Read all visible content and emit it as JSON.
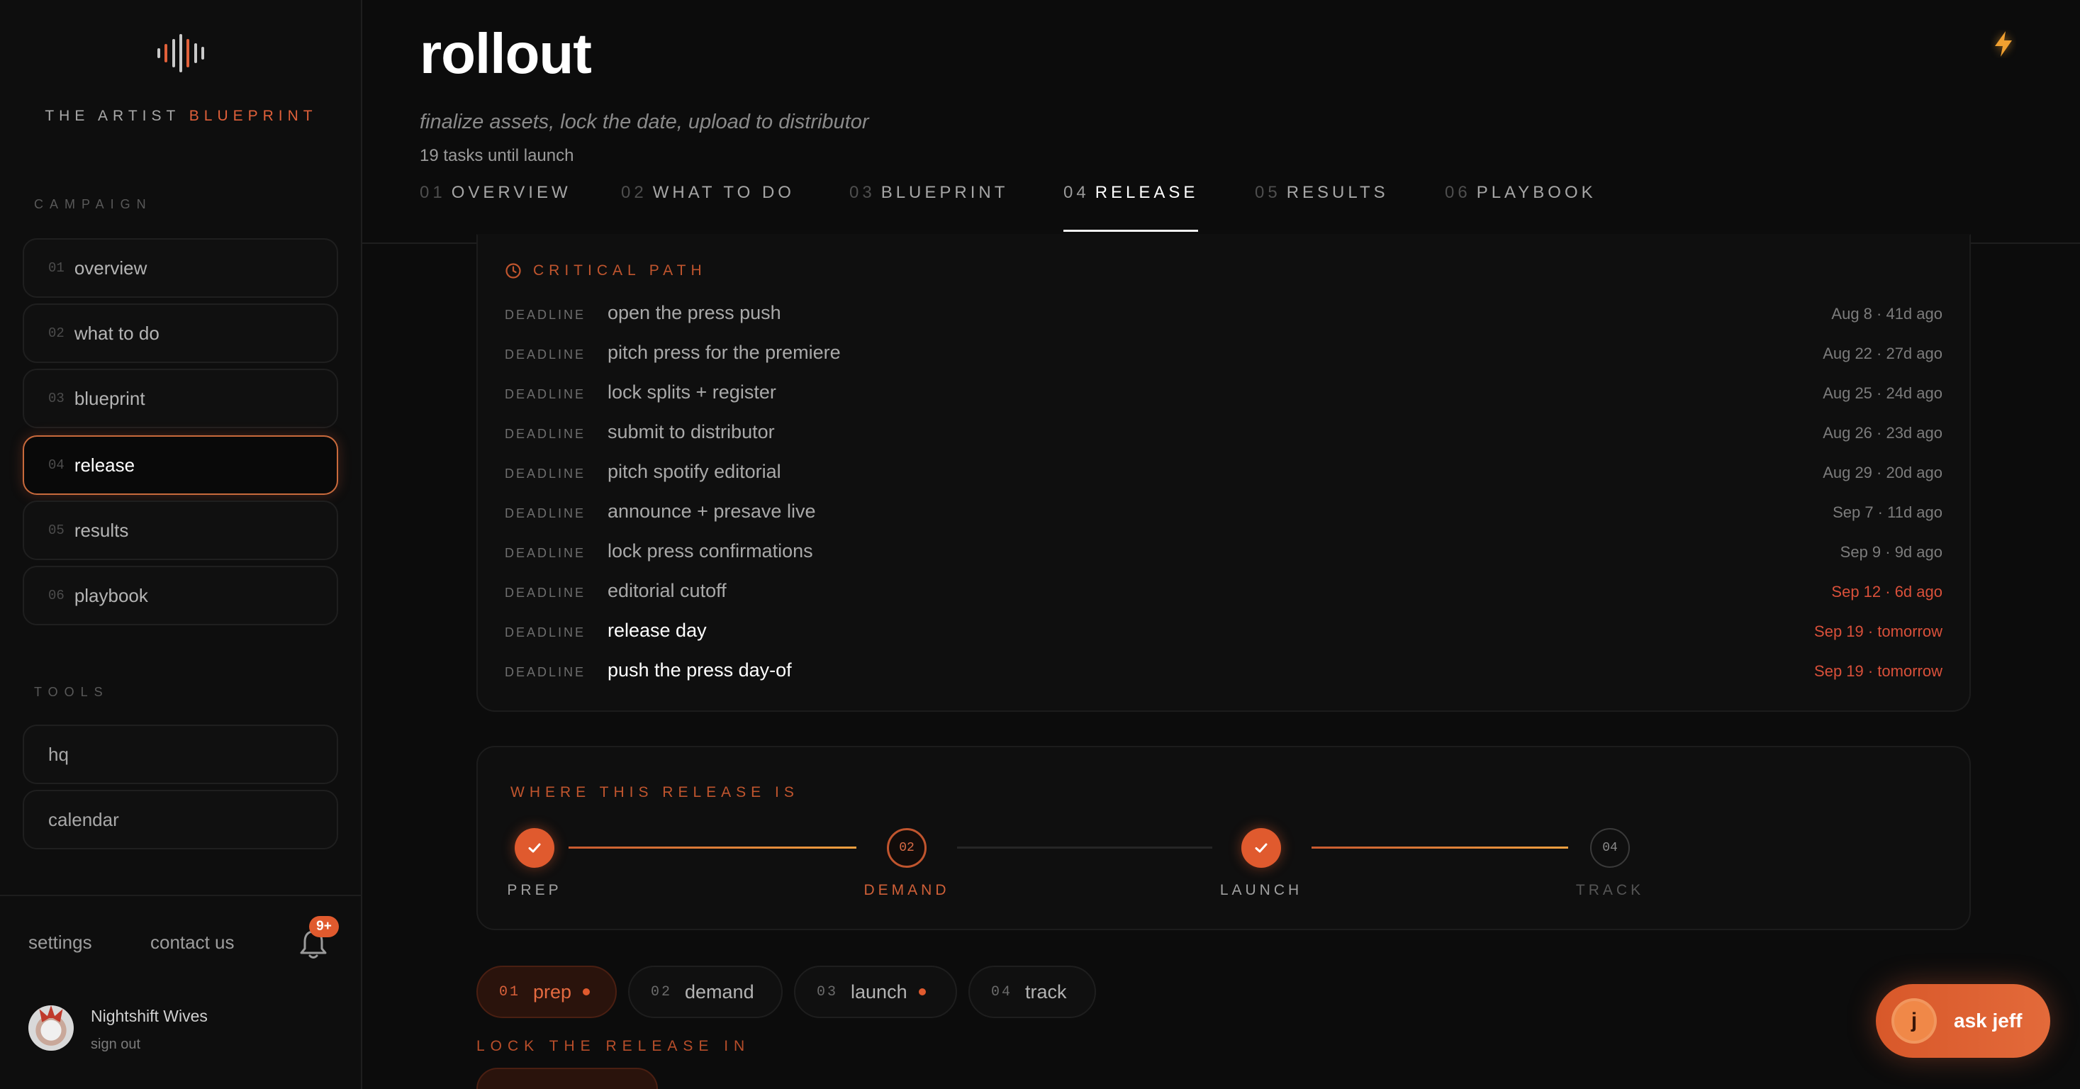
{
  "brand": {
    "prefix": "THE ARTIST",
    "accent": "BLUEPRINT"
  },
  "sidebar": {
    "campaign_label": "CAMPAIGN",
    "items": [
      {
        "num": "01",
        "label": "overview"
      },
      {
        "num": "02",
        "label": "what to do"
      },
      {
        "num": "03",
        "label": "blueprint"
      },
      {
        "num": "04",
        "label": "release",
        "active": true
      },
      {
        "num": "05",
        "label": "results"
      },
      {
        "num": "06",
        "label": "playbook"
      }
    ],
    "tools_label": "TOOLS",
    "tools": [
      {
        "label": "hq"
      },
      {
        "label": "calendar"
      }
    ],
    "footer": {
      "settings": "settings",
      "contact": "contact us",
      "badge": "9+"
    },
    "user": {
      "name": "Nightshift Wives",
      "sign_out": "sign out"
    }
  },
  "header": {
    "title": "rollout",
    "subtitle": "finalize assets, lock the date, upload to distributor",
    "task_count": "19 tasks until launch",
    "tabs": [
      {
        "num": "01",
        "label": "OVERVIEW"
      },
      {
        "num": "02",
        "label": "WHAT TO DO"
      },
      {
        "num": "03",
        "label": "BLUEPRINT"
      },
      {
        "num": "04",
        "label": "RELEASE",
        "active": true
      },
      {
        "num": "05",
        "label": "RESULTS"
      },
      {
        "num": "06",
        "label": "PLAYBOOK"
      }
    ]
  },
  "critical_path": {
    "title": "CRITICAL PATH",
    "rows": [
      {
        "tag": "DEADLINE",
        "task": "open the press push",
        "when": "Aug 8 · 41d ago"
      },
      {
        "tag": "DEADLINE",
        "task": "pitch press for the premiere",
        "when": "Aug 22 · 27d ago"
      },
      {
        "tag": "DEADLINE",
        "task": "lock splits + register",
        "when": "Aug 25 · 24d ago"
      },
      {
        "tag": "DEADLINE",
        "task": "submit to distributor",
        "when": "Aug 26 · 23d ago"
      },
      {
        "tag": "DEADLINE",
        "task": "pitch spotify editorial",
        "when": "Aug 29 · 20d ago"
      },
      {
        "tag": "DEADLINE",
        "task": "announce + presave live",
        "when": "Sep 7 · 11d ago"
      },
      {
        "tag": "DEADLINE",
        "task": "lock press confirmations",
        "when": "Sep 9 · 9d ago"
      },
      {
        "tag": "DEADLINE",
        "task": "editorial cutoff",
        "when": "Sep 12 · 6d ago"
      },
      {
        "tag": "DEADLINE",
        "task": "release day",
        "when": "Sep 19 · tomorrow"
      },
      {
        "tag": "DEADLINE",
        "task": "push the press day-of",
        "when": "Sep 19 · tomorrow"
      }
    ]
  },
  "progress": {
    "title": "WHERE THIS RELEASE IS",
    "steps": [
      {
        "label": "PREP",
        "state": "done"
      },
      {
        "num": "02",
        "label": "DEMAND",
        "state": "current"
      },
      {
        "label": "LAUNCH",
        "state": "done"
      },
      {
        "num": "04",
        "label": "TRACK",
        "state": "todo"
      }
    ]
  },
  "phases": [
    {
      "num": "01",
      "label": "prep"
    },
    {
      "num": "02",
      "label": "demand"
    },
    {
      "num": "03",
      "label": "launch"
    },
    {
      "num": "04",
      "label": "track"
    }
  ],
  "lock_title": "LOCK THE RELEASE IN",
  "ask": {
    "initial": "j",
    "label": "ask jeff"
  },
  "colors": {
    "accent": "#e05a2e",
    "background": "#0c0c0c",
    "late": "#d9503a"
  }
}
